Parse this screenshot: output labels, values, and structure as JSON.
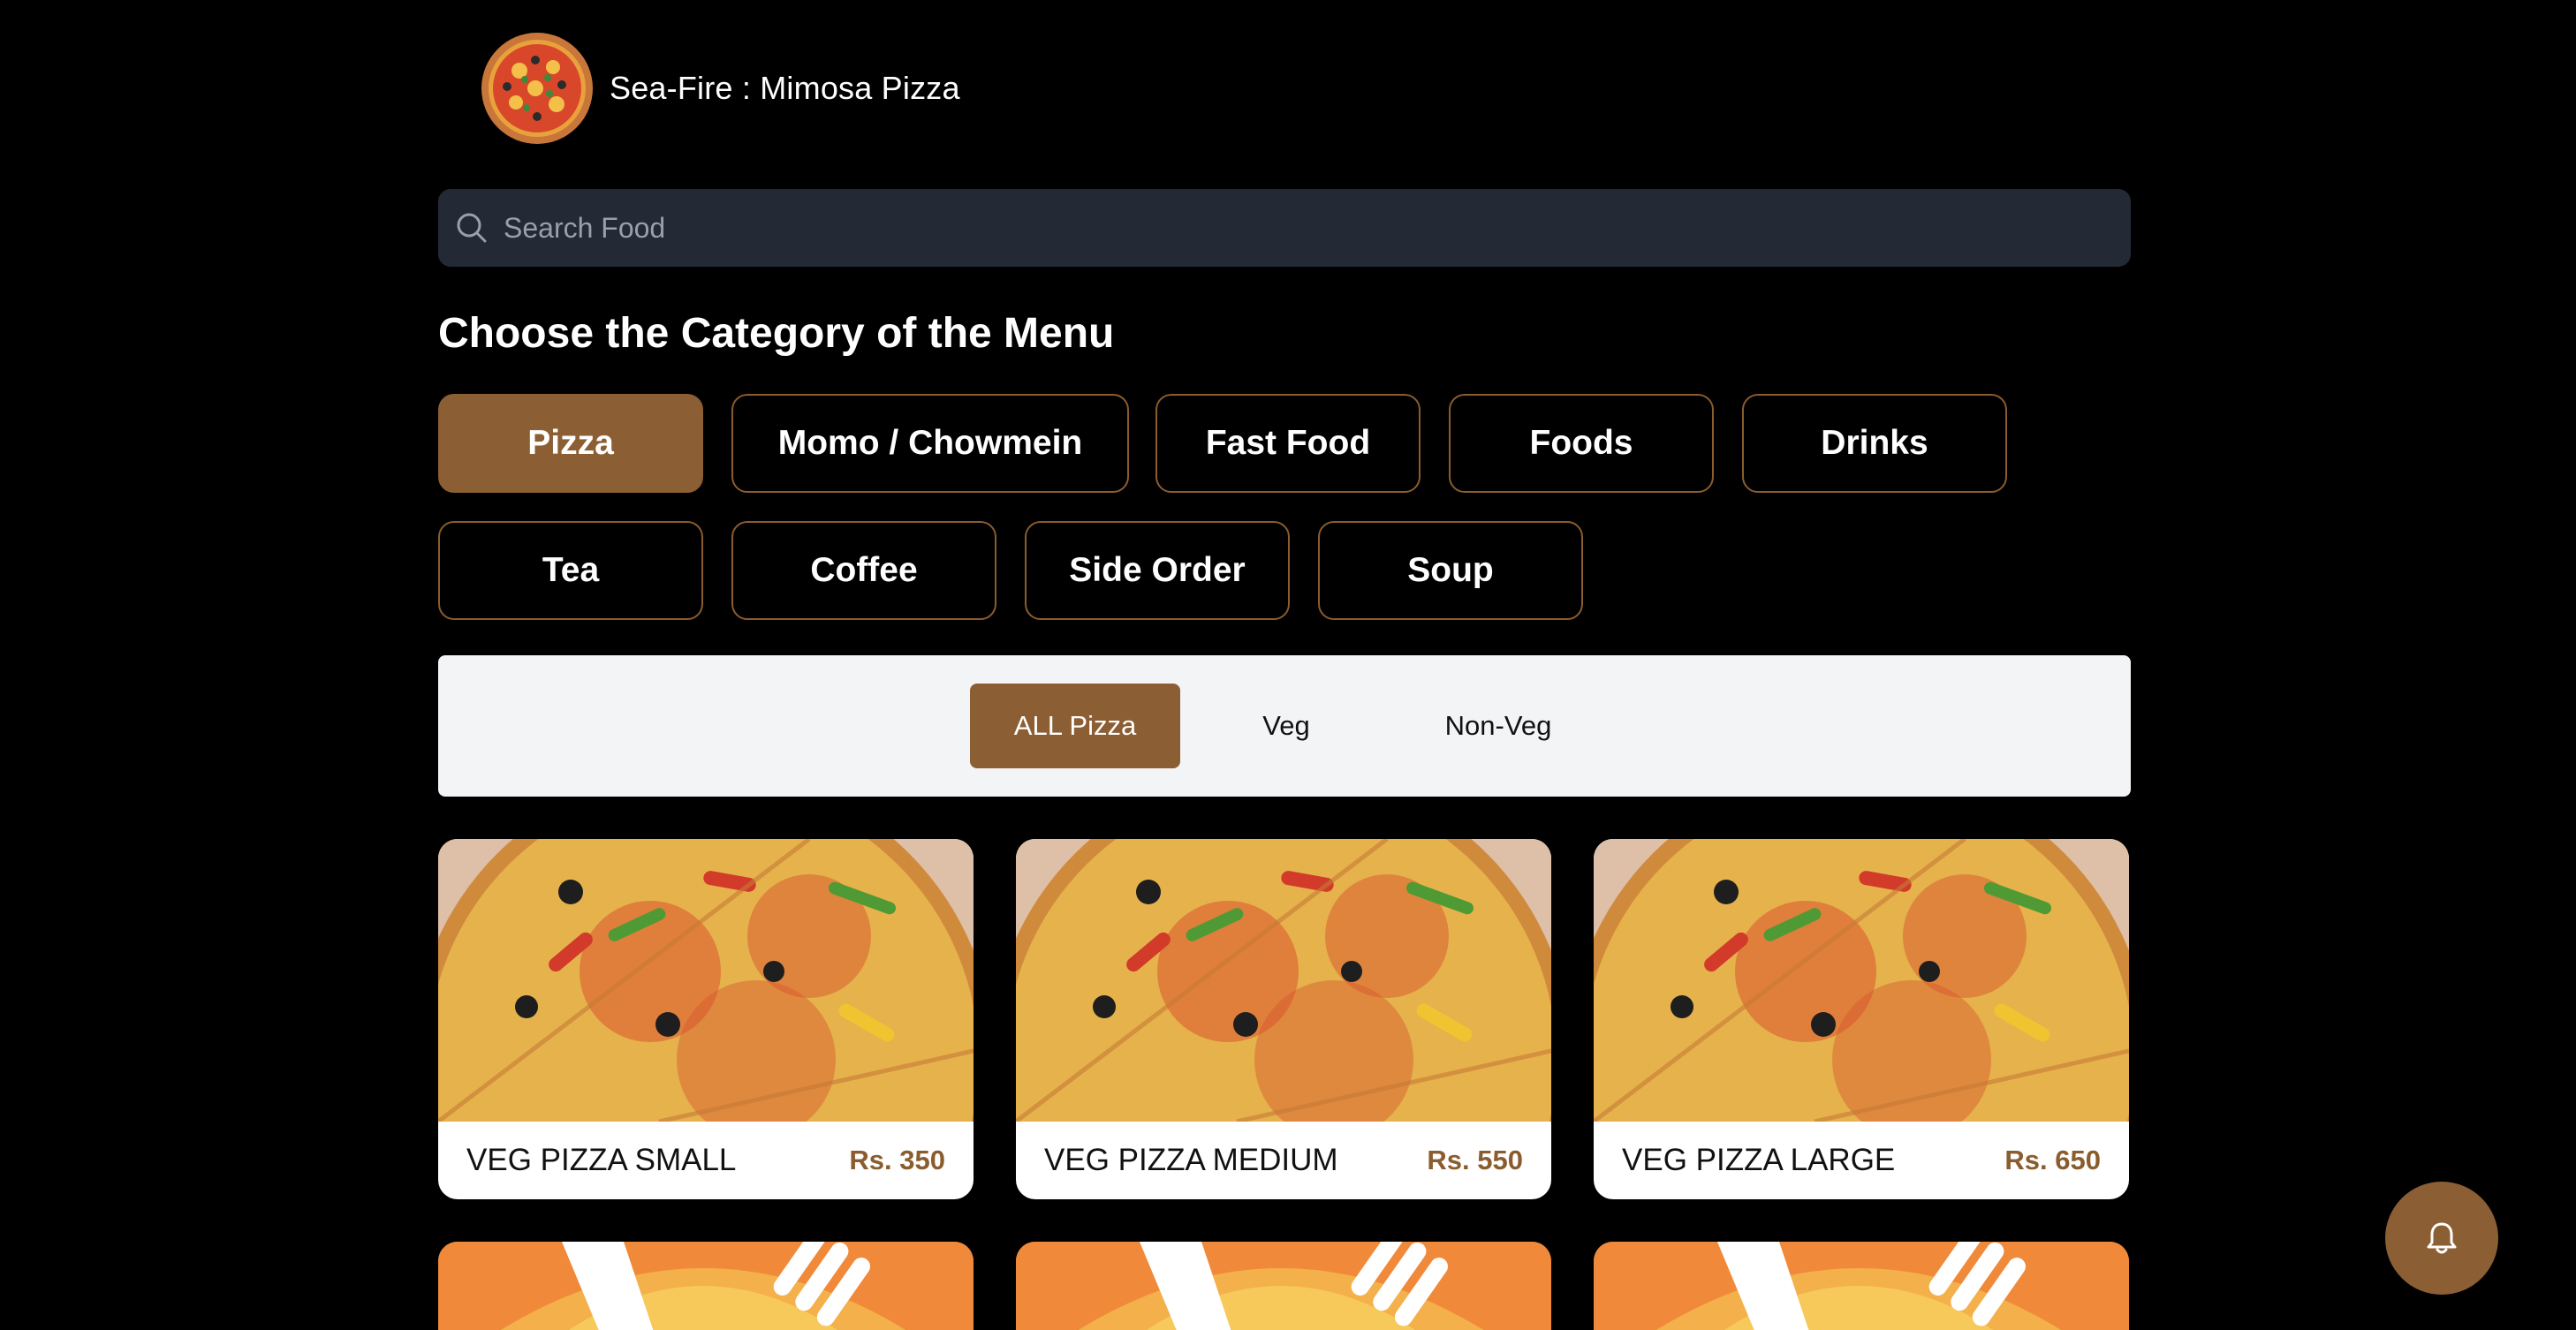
{
  "header": {
    "brand": "Sea-Fire : Mimosa Pizza",
    "logo_icon": "pizza-logo-icon"
  },
  "search": {
    "placeholder": "Search Food",
    "value": "",
    "icon": "search-icon"
  },
  "category_section": {
    "title": "Choose the Category of the Menu",
    "categories": [
      {
        "label": "Pizza",
        "active": true
      },
      {
        "label": "Momo / Chowmein",
        "active": false
      },
      {
        "label": "Fast Food",
        "active": false
      },
      {
        "label": "Foods",
        "active": false
      },
      {
        "label": "Drinks",
        "active": false
      },
      {
        "label": "Tea",
        "active": false
      },
      {
        "label": "Coffee",
        "active": false
      },
      {
        "label": "Side Order",
        "active": false
      },
      {
        "label": "Soup",
        "active": false
      }
    ]
  },
  "filters": [
    {
      "label": "ALL Pizza",
      "active": true
    },
    {
      "label": "Veg",
      "active": false
    },
    {
      "label": "Non-Veg",
      "active": false
    }
  ],
  "products": [
    {
      "name": "VEG PIZZA SMALL",
      "price": "Rs. 350"
    },
    {
      "name": "VEG PIZZA MEDIUM",
      "price": "Rs. 550"
    },
    {
      "name": "VEG PIZZA LARGE",
      "price": "Rs. 650"
    }
  ],
  "colors": {
    "accent": "#8c5e33",
    "background": "#000000",
    "search_bg": "#232935",
    "filter_bg": "#f3f4f6",
    "placeholder_orange": "#f08a3a"
  },
  "floating": {
    "icon": "bell-icon"
  }
}
